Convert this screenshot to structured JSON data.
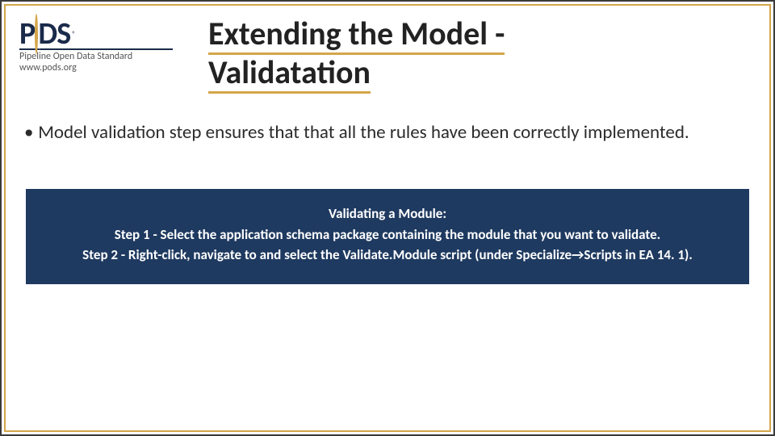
{
  "logo": {
    "word": "P   DS",
    "trademark": "®",
    "subline1": "Pipeline Open Data Standard",
    "subline2": "www.pods.org"
  },
  "title": {
    "line1": "Extending the Model -",
    "line2": "Validatation"
  },
  "bullet": {
    "text": "Model validation step ensures that that all the rules have been correctly implemented."
  },
  "callout": {
    "heading": "Validating a Module:",
    "step1": "Step 1 - Select the application schema package containing the module that you want to validate.",
    "step2": "Step 2 - Right-click, navigate to and select the Validate.Module script (under Specialize→Scripts in EA 14. 1)."
  }
}
